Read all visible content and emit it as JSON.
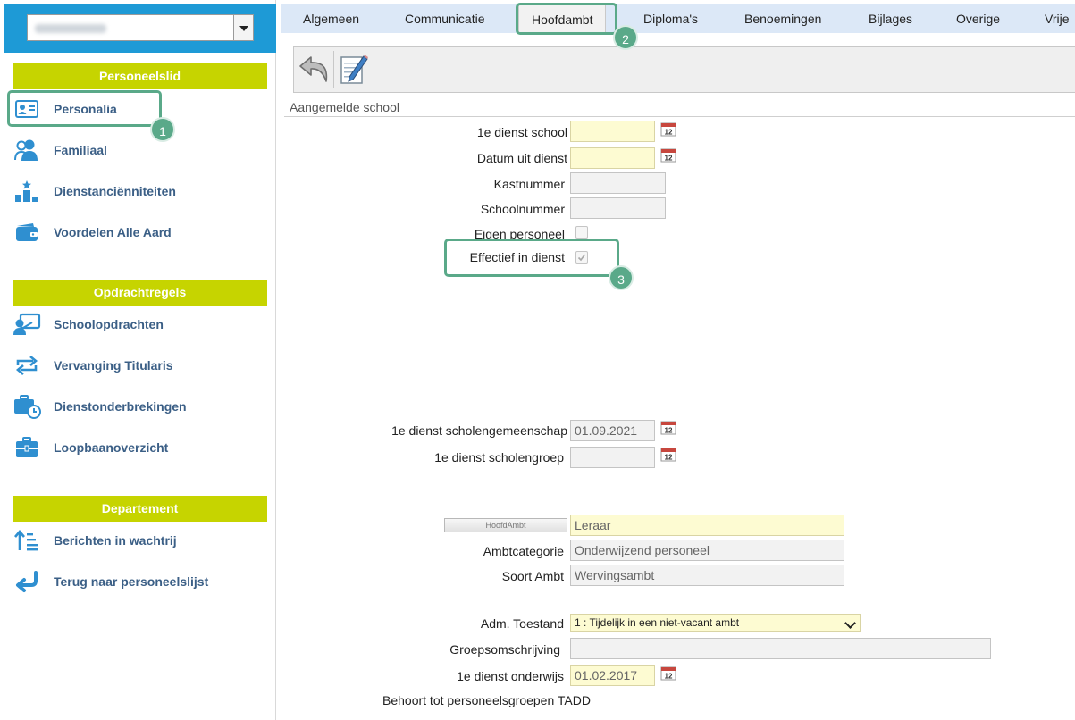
{
  "sidebar": {
    "sections": {
      "personeelslid": "Personeelslid",
      "opdrachtregels": "Opdrachtregels",
      "departement": "Departement"
    },
    "items": [
      {
        "label": "Personalia",
        "icon": "id-card-icon"
      },
      {
        "label": "Familiaal",
        "icon": "users-icon"
      },
      {
        "label": "Dienstanciënniteiten",
        "icon": "podium-icon"
      },
      {
        "label": "Voordelen Alle Aard",
        "icon": "wallet-icon"
      },
      {
        "label": "Schoolopdrachten",
        "icon": "teacher-board-icon"
      },
      {
        "label": "Vervanging Titularis",
        "icon": "swap-arrows-icon"
      },
      {
        "label": "Dienstonderbrekingen",
        "icon": "briefcase-clock-icon"
      },
      {
        "label": "Loopbaanoverzicht",
        "icon": "briefcase-icon"
      },
      {
        "label": "Berichten in wachtrij",
        "icon": "sort-list-icon"
      },
      {
        "label": "Terug naar personeelslijst",
        "icon": "return-arrow-icon"
      }
    ]
  },
  "tabs": [
    "Algemeen",
    "Communicatie",
    "Hoofdambt",
    "Diploma's",
    "Benoemingen",
    "Bijlages",
    "Overige",
    "Vrije"
  ],
  "active_tab": "Hoofdambt",
  "badges": [
    "1",
    "2",
    "3"
  ],
  "caption": "Aangemelde school",
  "form": {
    "eerste_dienst_school": {
      "label": "1e dienst school",
      "value": ""
    },
    "datum_uit_dienst": {
      "label": "Datum uit dienst",
      "value": ""
    },
    "kastnummer": {
      "label": "Kastnummer",
      "value": ""
    },
    "schoolnummer": {
      "label": "Schoolnummer",
      "value": ""
    },
    "eigen_personeel": {
      "label": "Eigen personeel",
      "checked": false
    },
    "effectief_in_dienst": {
      "label": "Effectief in dienst",
      "checked": true
    },
    "eerste_dienst_scholengemeenschap": {
      "label": "1e dienst scholengemeenschap",
      "value": "01.09.2021"
    },
    "eerste_dienst_scholengroep": {
      "label": "1e dienst scholengroep",
      "value": ""
    },
    "hoofdambt_button": "HoofdAmbt",
    "hoofdambt": {
      "value": "Leraar"
    },
    "ambtcategorie": {
      "label": "Ambtcategorie",
      "value": "Onderwijzend personeel"
    },
    "soort_ambt": {
      "label": "Soort Ambt",
      "value": "Wervingsambt"
    },
    "adm_toestand": {
      "label": "Adm. Toestand",
      "value": "1 : Tijdelijk in een niet-vacant ambt"
    },
    "groepsomschrijving": {
      "label": "Groepsomschrijving",
      "value": ""
    },
    "eerste_dienst_onderwijs": {
      "label": "1e dienst onderwijs",
      "value": "01.02.2017"
    },
    "personeelsgroepen": {
      "label": "Behoort tot personeelsgroepen TADD"
    }
  },
  "colors": {
    "accent_green": "#c6d400",
    "brand_blue": "#1e9ad6",
    "highlight": "#5aa989",
    "link_blue": "#3b5f86",
    "icon_blue": "#2f8fd0"
  }
}
